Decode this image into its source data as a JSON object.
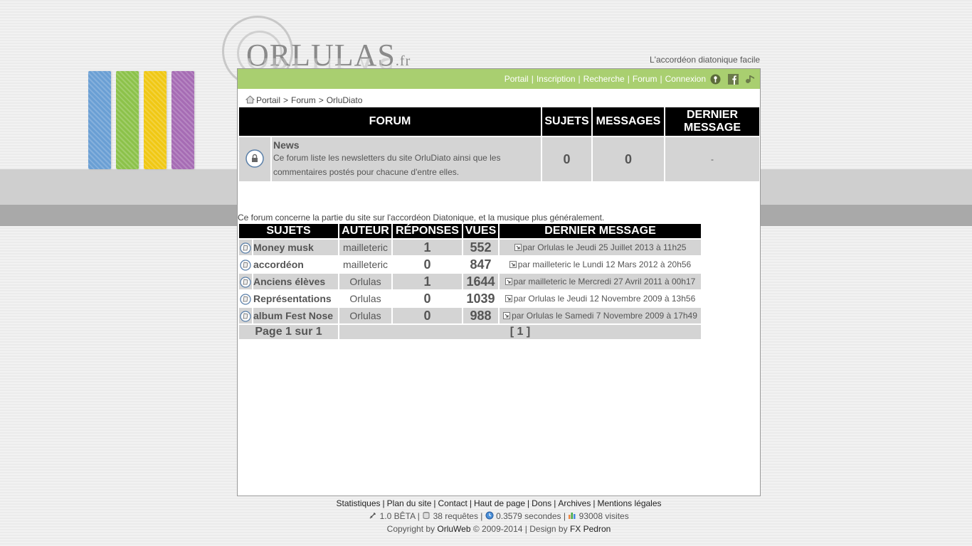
{
  "header": {
    "logo_main": "ORLULAS",
    "logo_ext": ".fr",
    "tagline": "L'accordéon diatonique facile",
    "strip_colors": [
      "#6a9fd4",
      "#8cc24a",
      "#f0c814",
      "#a66cb4"
    ]
  },
  "topnav": {
    "items": [
      "Portail",
      "Inscription",
      "Recherche",
      "Forum",
      "Connexion"
    ],
    "icons": [
      "key-icon",
      "facebook-icon",
      "music-note-icon"
    ]
  },
  "breadcrumb": [
    "Portail",
    "Forum",
    "OrluDiato"
  ],
  "forum_table": {
    "headers": [
      "FORUM",
      "SUJETS",
      "MESSAGES",
      "DERNIER MESSAGE"
    ],
    "row": {
      "name": "News",
      "description": "Ce forum liste les newsletters du site OrluDiato ainsi que les commentaires postés pour chacune d'entre elles.",
      "sujets": "0",
      "messages": "0",
      "dernier": "-"
    }
  },
  "forum_description": "Ce forum concerne la partie du site sur l'accordéon Diatonique, et la musique plus généralement.",
  "topics": {
    "headers": [
      "SUJETS",
      "AUTEUR",
      "RÉPONSES",
      "VUES",
      "DERNIER MESSAGE"
    ],
    "rows": [
      {
        "title": "Money musk",
        "author": "mailleteric",
        "replies": "1",
        "views": "552",
        "last": "par Orlulas le Jeudi 25 Juillet 2013 à 11h25"
      },
      {
        "title": "accordéon",
        "author": "mailleteric",
        "replies": "0",
        "views": "847",
        "last": "par mailleteric le Lundi 12 Mars 2012 à 20h56"
      },
      {
        "title": "Anciens élèves",
        "author": "Orlulas",
        "replies": "1",
        "views": "1644",
        "last": "par mailleteric le Mercredi 27 Avril 2011 à 00h17"
      },
      {
        "title": "Représentations",
        "author": "Orlulas",
        "replies": "0",
        "views": "1039",
        "last": "par Orlulas le Jeudi 12 Novembre 2009 à 13h56"
      },
      {
        "title": "album Fest Nose",
        "author": "Orlulas",
        "replies": "0",
        "views": "988",
        "last": "par Orlulas le Samedi 7 Novembre 2009 à 17h49"
      }
    ],
    "page_info": "Page 1 sur 1",
    "pages": "[ 1 ]"
  },
  "footer": {
    "links": [
      "Statistiques",
      "Plan du site",
      "Contact",
      "Haut de page",
      "Dons",
      "Archives",
      "Mentions légales"
    ],
    "version": "1.0 BÊTA",
    "requests": "38 requêtes",
    "time": "0.3579 secondes",
    "visits": "93008 visites",
    "copyright_prefix": "Copyright by",
    "copyright_owner": "OrluWeb",
    "copyright_years": "© 2009-2014 | Design by",
    "designer": "FX Pedron"
  }
}
